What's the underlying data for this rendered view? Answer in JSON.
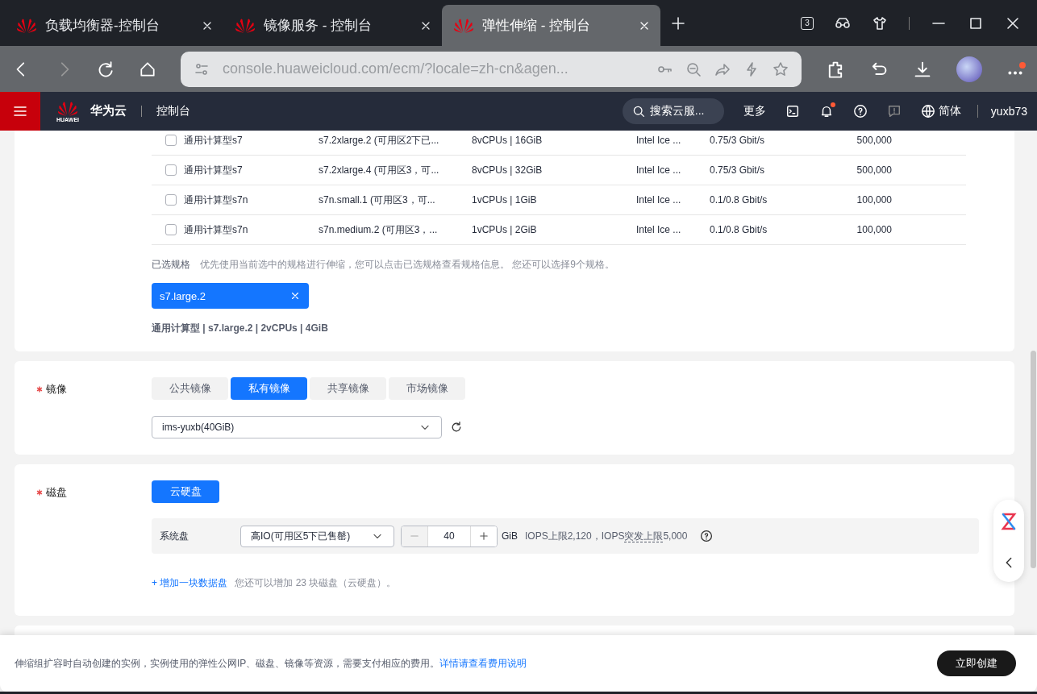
{
  "browser": {
    "tabs": [
      {
        "title": "负载均衡器-控制台",
        "selected": false
      },
      {
        "title": "镜像服务 - 控制台",
        "selected": false
      },
      {
        "title": "弹性伸缩 - 控制台",
        "selected": true
      }
    ],
    "tab_count": "3",
    "url": "console.huaweicloud.com/ecm/?locale=zh-cn&agen..."
  },
  "header": {
    "logo_text": "HUAWEI",
    "brand": "华为云",
    "console": "控制台",
    "search_placeholder": "搜索云服...",
    "more": "更多",
    "language": "简体",
    "user": "yuxb73"
  },
  "flavor_table": {
    "rows": [
      {
        "checked": false,
        "type": "通用计算型s7",
        "flavor": "s7.2xlarge.2 (可用区2下已...",
        "vcpus": "8vCPUs | 16GiB",
        "cpu": "Intel Ice ...",
        "bandwidth": "0.75/3 Gbit/s",
        "pps": "500,000"
      },
      {
        "checked": false,
        "type": "通用计算型s7",
        "flavor": "s7.2xlarge.4 (可用区3，可...",
        "vcpus": "8vCPUs | 32GiB",
        "cpu": "Intel Ice ...",
        "bandwidth": "0.75/3 Gbit/s",
        "pps": "500,000"
      },
      {
        "checked": false,
        "type": "通用计算型s7n",
        "flavor": "s7n.small.1 (可用区3，可...",
        "vcpus": "1vCPUs | 1GiB",
        "cpu": "Intel Ice ...",
        "bandwidth": "0.1/0.8 Gbit/s",
        "pps": "100,000"
      },
      {
        "checked": false,
        "type": "通用计算型s7n",
        "flavor": "s7n.medium.2 (可用区3，...",
        "vcpus": "1vCPUs | 2GiB",
        "cpu": "Intel Ice ...",
        "bandwidth": "0.1/0.8 Gbit/s",
        "pps": "100,000"
      }
    ]
  },
  "selected_flavors": {
    "label": "已选规格",
    "hint": "优先使用当前选中的规格进行伸缩，您可以点击已选规格查看规格信息。 您还可以选择9个规格。",
    "tags": [
      "s7.large.2"
    ],
    "summary": "通用计算型 | s7.large.2 | 2vCPUs | 4GiB"
  },
  "image": {
    "label": "镜像",
    "required": true,
    "tabs": [
      {
        "label": "公共镜像",
        "selected": false
      },
      {
        "label": "私有镜像",
        "selected": true
      },
      {
        "label": "共享镜像",
        "selected": false
      },
      {
        "label": "市场镜像",
        "selected": false
      }
    ],
    "value": "ims-yuxb(40GiB)"
  },
  "disk": {
    "label": "磁盘",
    "required": true,
    "type_button": "云硬盘",
    "system_disk": {
      "label": "系统盘",
      "type": "高IO(可用区5下已售罄)",
      "size": "40",
      "unit": "GiB",
      "iops_prefix": "IOPS上限2,120，IOPS",
      "iops_term": "突发上限",
      "iops_suffix": "5,000"
    },
    "add_link": "+ 增加一块数据盘",
    "add_hint": "您还可以增加 23 块磁盘（云硬盘）。"
  },
  "footer": {
    "notice": "伸缩组扩容时自动创建的实例，实例使用的弹性公网IP、磁盘、镜像等资源，需要支付相应的费用。",
    "link": "详情请查看费用说明",
    "create_button": "立即创建"
  }
}
